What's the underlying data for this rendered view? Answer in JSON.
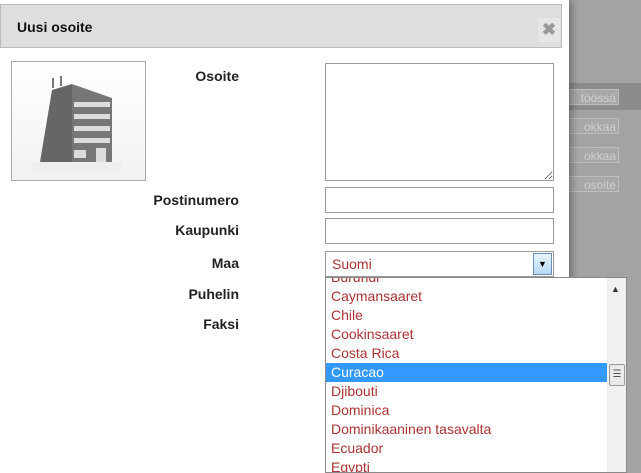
{
  "background": {
    "buttons": [
      "töössä",
      "okkaa",
      "okkaa",
      "osoite"
    ]
  },
  "dialog": {
    "title": "Uusi osoite",
    "close_icon": "close-icon",
    "labels": {
      "address": "Osoite",
      "postal": "Postinumero",
      "city": "Kaupunki",
      "country": "Maa",
      "phone": "Puhelin",
      "fax": "Faksi"
    },
    "country_value": "Suomi",
    "country_options": [
      "Burundi",
      "Caymansaaret",
      "Chile",
      "Cookinsaaret",
      "Costa Rica",
      "Curacao",
      "Djibouti",
      "Dominica",
      "Dominikaaninen tasavalta",
      "Ecuador",
      "Egypti"
    ],
    "highlighted_option": "Curacao"
  }
}
